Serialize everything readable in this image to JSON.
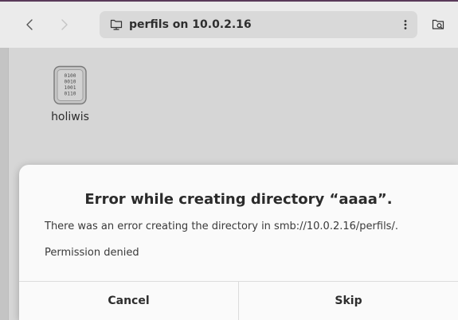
{
  "header": {
    "location_label": "perfils on 10.0.2.16"
  },
  "files": [
    {
      "name": "holiwis",
      "icon": "binary-file-icon"
    }
  ],
  "dialog": {
    "title": "Error while creating directory “aaaa”.",
    "message": "There was an error creating the directory in smb://10.0.2.16/perfils/.",
    "detail": "Permission denied",
    "cancel_label": "Cancel",
    "skip_label": "Skip"
  },
  "colors": {
    "header_bg": "#ebebeb",
    "location_bg": "#d9d9d9",
    "content_bg": "#f4f4f4",
    "dialog_bg": "#fafafa"
  }
}
